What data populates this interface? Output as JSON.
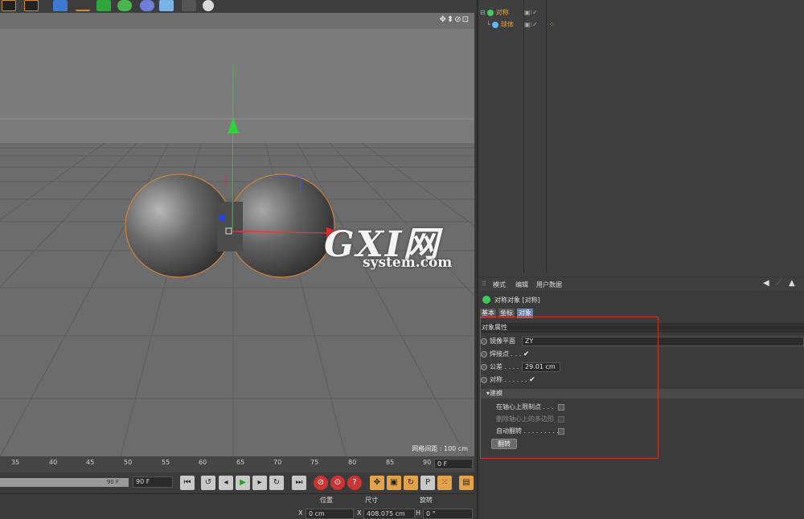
{
  "toolbar": {
    "icons": [
      "render-view-icon",
      "render-picture-icon",
      "cube-icon",
      "spline-icon",
      "nurbs-icon",
      "array-icon",
      "deformer-icon",
      "floor-icon",
      "camera-icon",
      "light-icon"
    ]
  },
  "viewport": {
    "grid_label": "网格间距 : 100 cm",
    "nav_icons": "✥⬍⊘⊡"
  },
  "timeline": {
    "ticks": [
      "35",
      "40",
      "45",
      "50",
      "55",
      "60",
      "65",
      "70",
      "75",
      "80",
      "85",
      "90"
    ],
    "current_frame": "0 F"
  },
  "transport": {
    "range_end": "90 F",
    "end_field": "90 F"
  },
  "coords": {
    "position_label": "位置",
    "size_label": "尺寸",
    "rotation_label": "旋转",
    "x_axis": "X",
    "h_axis": "H",
    "pos_x": "0 cm",
    "size_x": "408.075 cm",
    "rot_h": "0 °"
  },
  "object_manager": {
    "objects": [
      {
        "name": "对称",
        "indent": 0
      },
      {
        "name": "球体",
        "indent": 1
      }
    ]
  },
  "attribute_manager": {
    "menu": [
      "模式",
      "编辑",
      "用户数据"
    ],
    "title": "对称对象 [对称]",
    "tabs": [
      "基本",
      "坐标",
      "对象"
    ],
    "active_tab": "对象",
    "group": "对象属性",
    "props": {
      "mirror_plane_label": "镜像平面",
      "mirror_plane_value": "ZY",
      "weld_label": "焊接点 . . .",
      "weld_checked": "✔",
      "tolerance_label": "公差 . . . . . .",
      "tolerance_value": "29.01 cm",
      "symmetry_label": "对称 . . . . . .",
      "symmetry_checked": "✔"
    },
    "subgroup": "▾建模",
    "sub_props": {
      "clamp_label": "在轴心上限制点 . . .",
      "delete_label": "删除轴心上的多边形",
      "autoflip_label": "自动翻转 . . . . . . . . ."
    },
    "flip_button": "翻转"
  },
  "watermark": {
    "big": "GXI网",
    "small": "system.com"
  },
  "colors": {
    "accent_orange": "#e8a33b",
    "highlight_box": "#c0392b",
    "active_tab": "#6b83a8"
  }
}
